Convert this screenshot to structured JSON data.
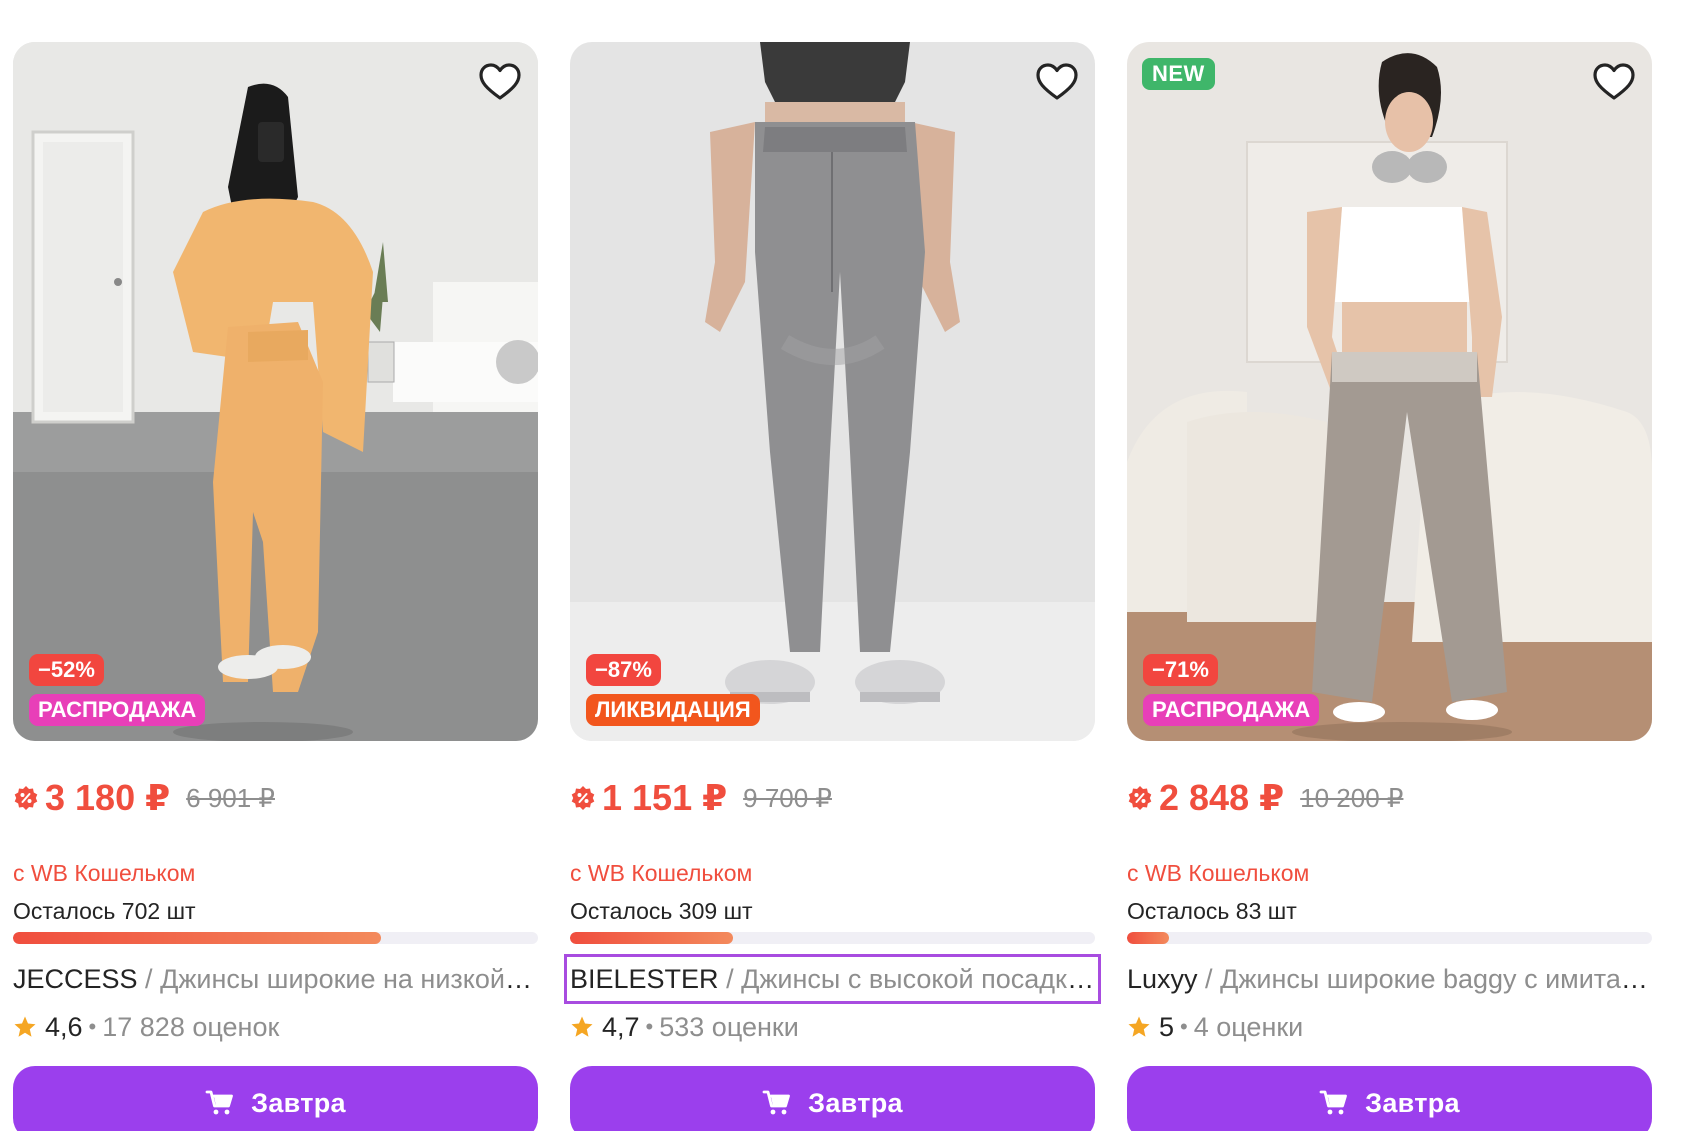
{
  "products": [
    {
      "badge_new": "",
      "discount": "−52%",
      "promo": "РАСПРОДАЖА",
      "price": "3 180 ₽",
      "old_price": "6 901 ₽",
      "wallet_note": "с WB Кошельком",
      "stock": "Осталось 702 шт",
      "stock_fraction": 0.7,
      "brand": "JECCESS",
      "separator": " / ",
      "name": "Джинсы широкие на низкой посадке",
      "rating": "4,6",
      "reviews": "17 828 оценок",
      "button_label": "Завтра",
      "focused": false
    },
    {
      "badge_new": "",
      "discount": "−87%",
      "promo": "ЛИКВИДАЦИЯ",
      "price": "1 151 ₽",
      "old_price": "9 700 ₽",
      "wallet_note": "с WB Кошельком",
      "stock": "Осталось 309 шт",
      "stock_fraction": 0.31,
      "brand": "BIELESTER",
      "separator": " / ",
      "name": "Джинсы с высокой посадкой",
      "rating": "4,7",
      "reviews": "533 оценки",
      "button_label": "Завтра",
      "focused": true
    },
    {
      "badge_new": "NEW",
      "discount": "−71%",
      "promo": "РАСПРОДАЖА",
      "price": "2 848 ₽",
      "old_price": "10 200 ₽",
      "wallet_note": "с WB Кошельком",
      "stock": "Осталось 83 шт",
      "stock_fraction": 0.08,
      "brand": "Luxyy",
      "separator": " / ",
      "name": "Джинсы широкие baggy с имитацией",
      "rating": "5",
      "reviews": "4 оценки",
      "button_label": "Завтра",
      "focused": false
    }
  ],
  "icons": {
    "favorite": "heart-outline-icon",
    "wallet": "wallet-discount-icon",
    "rating": "star-icon",
    "cart": "cart-icon"
  },
  "colors": {
    "price": "#f04e3e",
    "button": "#9b3fed",
    "discount_badge": "#f2463f",
    "sale_badge": "#e83fb8",
    "liquidation_badge": "#f2561d",
    "new_badge": "#3fb66a",
    "star": "#f5a623",
    "focus_outline": "#a84ce0"
  }
}
